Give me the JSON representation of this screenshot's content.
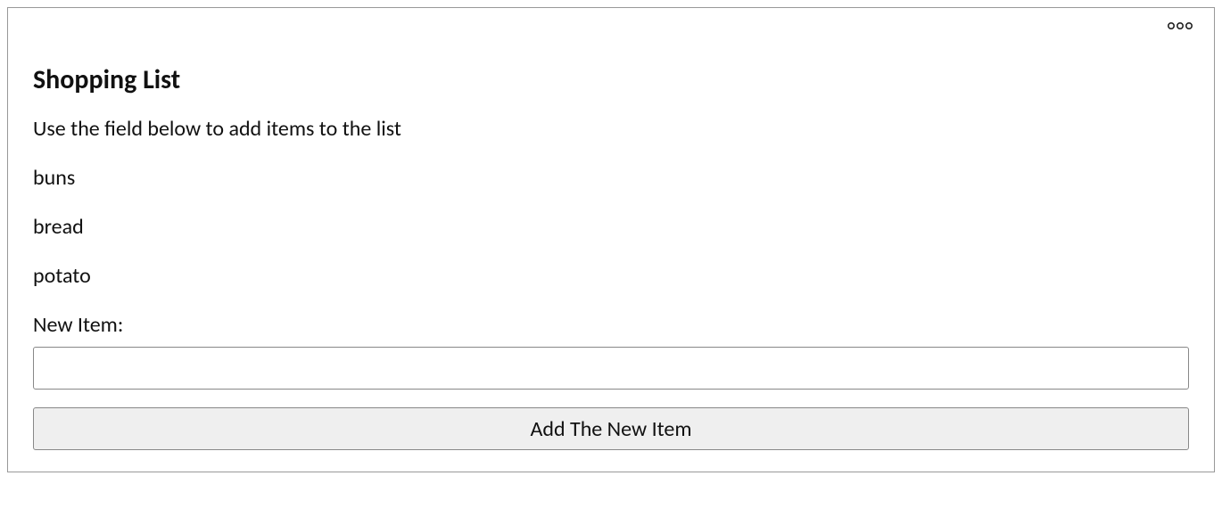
{
  "card": {
    "title": "Shopping List",
    "description": "Use the field below to add items to the list",
    "items": [
      "buns",
      "bread",
      "potato"
    ],
    "new_item_label": "New Item:",
    "input_value": "",
    "add_button_label": "Add The New Item"
  }
}
